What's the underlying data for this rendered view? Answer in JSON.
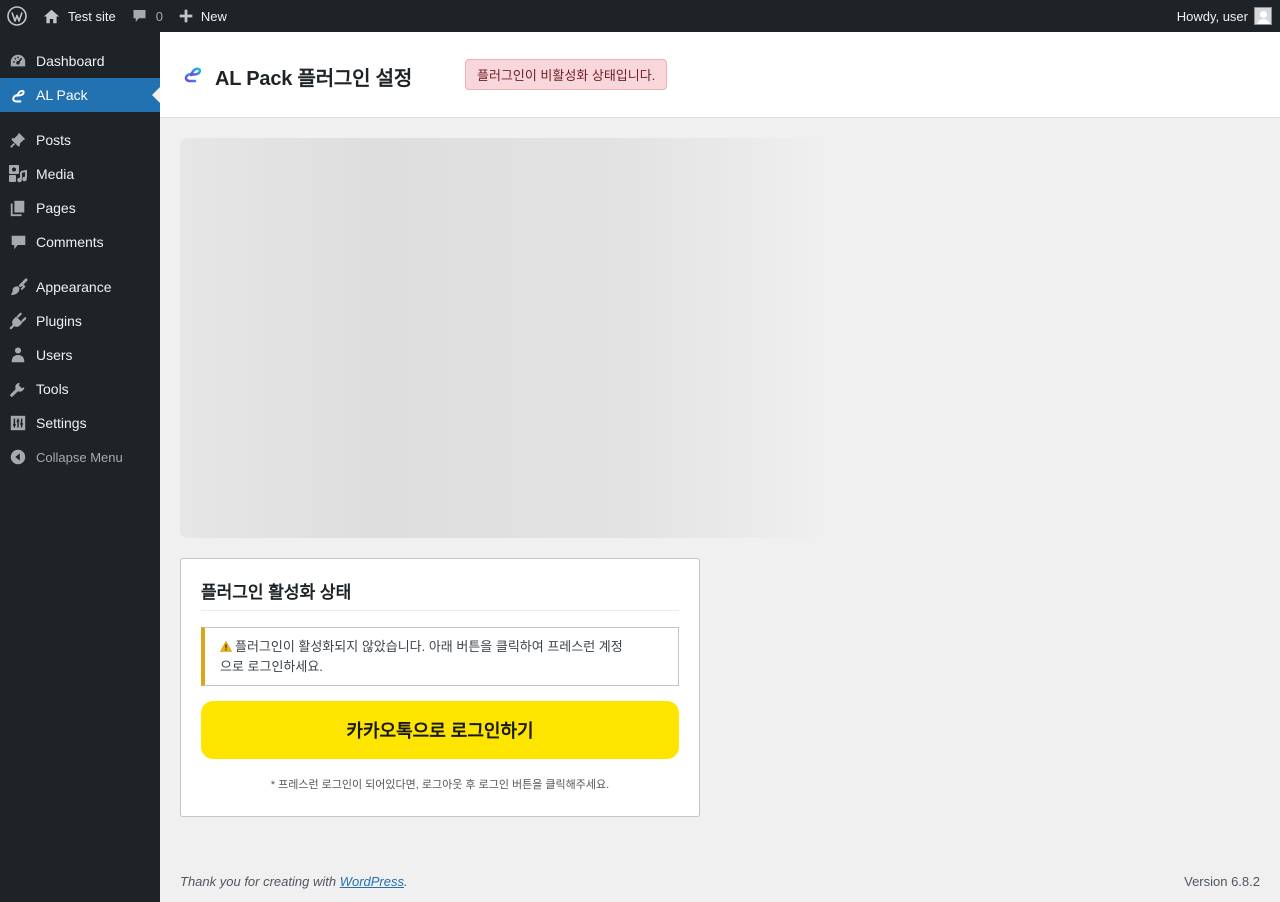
{
  "adminbar": {
    "site_name": "Test site",
    "comment_count": "0",
    "new_label": "New",
    "howdy": "Howdy, user"
  },
  "sidebar": {
    "items": [
      {
        "label": "Dashboard",
        "icon": "dashboard-icon"
      },
      {
        "label": "AL Pack",
        "icon": "al-pack-icon",
        "current": true
      },
      {
        "label": "Posts",
        "icon": "pushpin-icon"
      },
      {
        "label": "Media",
        "icon": "media-icon"
      },
      {
        "label": "Pages",
        "icon": "pages-icon"
      },
      {
        "label": "Comments",
        "icon": "comment-icon"
      },
      {
        "label": "Appearance",
        "icon": "paintbrush-icon"
      },
      {
        "label": "Plugins",
        "icon": "plugin-icon"
      },
      {
        "label": "Users",
        "icon": "user-icon"
      },
      {
        "label": "Tools",
        "icon": "wrench-icon"
      },
      {
        "label": "Settings",
        "icon": "settings-icon"
      }
    ],
    "collapse_label": "Collapse Menu"
  },
  "header": {
    "title": "AL Pack 플러그인 설정",
    "status_badge": "플러그인이 비활성화 상태입니다."
  },
  "card": {
    "title": "플러그인 활성화 상태",
    "notice_line1": "플러그인이 활성화되지 않았습니다. 아래 버튼을 클릭하여 프레스런 계정",
    "notice_line2": "으로 로그인하세요.",
    "login_button": "카카오톡으로 로그인하기",
    "note": "* 프레스런 로그인이 되어있다면, 로그아웃 후 로그인 버튼을 클릭해주세요."
  },
  "footer": {
    "thanks_prefix": "Thank you for creating with ",
    "wordpress_link": "WordPress",
    "thanks_suffix": ".",
    "version": "Version 6.8.2"
  },
  "colors": {
    "adminbar_bg": "#1d2327",
    "menu_current": "#2271b1",
    "badge_bg": "#f8d7da",
    "badge_text": "#721c24",
    "notice_warning": "#dba617",
    "kakao_yellow": "#fee500"
  }
}
